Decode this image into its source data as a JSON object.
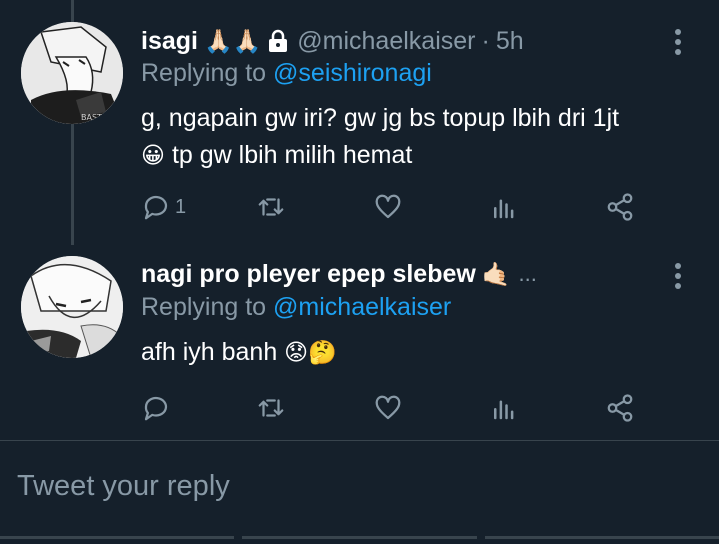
{
  "colors": {
    "background": "#15202b",
    "primary_text": "#ffffff",
    "secondary_text": "#8899a6",
    "link": "#1da1f2",
    "divider": "#38444d"
  },
  "tweets": [
    {
      "display_name": "isagi",
      "name_emoji": "🙏🏻🙏🏻",
      "lock_icon": "lock-icon",
      "handle": "@michaelkaiser",
      "separator": "·",
      "time": "5h",
      "replying_label": "Replying to",
      "replying_to": "@seishironagi",
      "text_line1": "g, ngapain gw iri? gw jg bs topup lbih dri 1jt",
      "text_line2_emoji": "😀",
      "text_line2": "tp gw lbih milih hemat",
      "reply_count": "1"
    },
    {
      "display_name": "nagi pro pleyer epep slebew",
      "name_emoji": "🤙🏻",
      "ellipsis": "...",
      "replying_label": "Replying to",
      "replying_to": "@michaelkaiser",
      "text": "afh iyh banh",
      "text_emoji": "😟🤔",
      "reply_count": ""
    }
  ],
  "reply_box": {
    "placeholder": "Tweet your reply"
  },
  "action_icons": [
    "reply-icon",
    "retweet-icon",
    "like-icon",
    "analytics-icon",
    "share-icon"
  ]
}
